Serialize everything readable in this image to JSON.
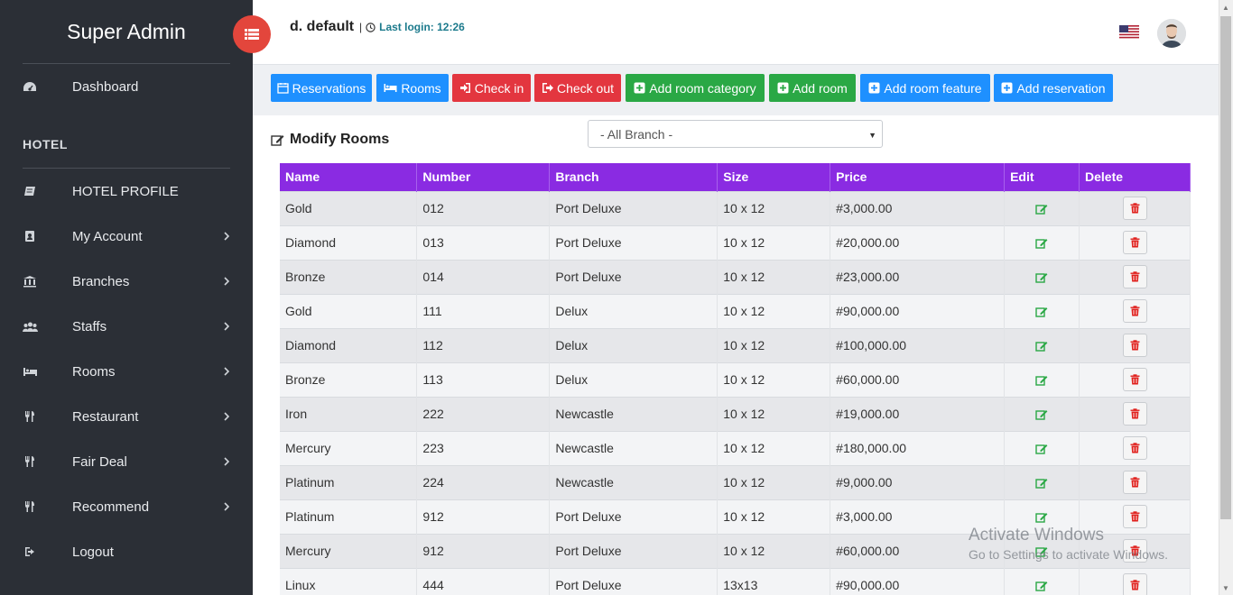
{
  "sidebar": {
    "brand": "Super Admin",
    "dashboard": "Dashboard",
    "section_label": "HOTEL",
    "items": [
      {
        "label": "HOTEL PROFILE",
        "icon": "book-icon"
      },
      {
        "label": "My Account",
        "icon": "contact-book-icon"
      },
      {
        "label": "Branches",
        "icon": "bank-icon"
      },
      {
        "label": "Staffs",
        "icon": "users-icon"
      },
      {
        "label": "Rooms",
        "icon": "bed-icon"
      },
      {
        "label": "Restaurant",
        "icon": "cutlery-icon"
      },
      {
        "label": "Fair Deal",
        "icon": "cutlery-icon"
      },
      {
        "label": "Recommend",
        "icon": "cutlery-icon"
      },
      {
        "label": "Logout",
        "icon": "sign-out-icon"
      }
    ]
  },
  "header": {
    "user_name": "d. default",
    "separator": "|",
    "last_login": "Last login: 12:26"
  },
  "actions": {
    "reservations": "Reservations",
    "rooms": "Rooms",
    "check_in": "Check in",
    "check_out": "Check out",
    "add_room_category": "Add room category",
    "add_room": "Add room",
    "add_room_feature": "Add room feature",
    "add_reservation": "Add reservation"
  },
  "panel": {
    "title": "Modify Rooms",
    "branch_select": "- All Branch -"
  },
  "table": {
    "columns": [
      "Name",
      "Number",
      "Branch",
      "Size",
      "Price",
      "Edit",
      "Delete"
    ],
    "rows": [
      {
        "name": "Gold",
        "number": "012",
        "branch": "Port Deluxe",
        "size": "10 x 12",
        "price": "#3,000.00"
      },
      {
        "name": "Diamond",
        "number": "013",
        "branch": "Port Deluxe",
        "size": "10 x 12",
        "price": "#20,000.00"
      },
      {
        "name": "Bronze",
        "number": "014",
        "branch": "Port Deluxe",
        "size": "10 x 12",
        "price": "#23,000.00"
      },
      {
        "name": "Gold",
        "number": "111",
        "branch": "Delux",
        "size": "10 x 12",
        "price": "#90,000.00"
      },
      {
        "name": "Diamond",
        "number": "112",
        "branch": "Delux",
        "size": "10 x 12",
        "price": "#100,000.00"
      },
      {
        "name": "Bronze",
        "number": "113",
        "branch": "Delux",
        "size": "10 x 12",
        "price": "#60,000.00"
      },
      {
        "name": "Iron",
        "number": "222",
        "branch": "Newcastle",
        "size": "10 x 12",
        "price": "#19,000.00"
      },
      {
        "name": "Mercury",
        "number": "223",
        "branch": "Newcastle",
        "size": "10 x 12",
        "price": "#180,000.00"
      },
      {
        "name": "Platinum",
        "number": "224",
        "branch": "Newcastle",
        "size": "10 x 12",
        "price": "#9,000.00"
      },
      {
        "name": "Platinum",
        "number": "912",
        "branch": "Port Deluxe",
        "size": "10 x 12",
        "price": "#3,000.00"
      },
      {
        "name": "Mercury",
        "number": "912",
        "branch": "Port Deluxe",
        "size": "10 x 12",
        "price": "#60,000.00"
      },
      {
        "name": "Linux",
        "number": "444",
        "branch": "Port Deluxe",
        "size": "13x13",
        "price": "#90,000.00"
      }
    ]
  },
  "watermark": {
    "line1": "Activate Windows",
    "line2": "Go to Settings to activate Windows."
  },
  "colors": {
    "sidebar_bg": "#2b2f36",
    "toggle_red": "#e3463c",
    "btn_blue": "#1e90ff",
    "btn_red": "#e3363f",
    "btn_green": "#2aa845",
    "table_header": "#8a2be2"
  }
}
